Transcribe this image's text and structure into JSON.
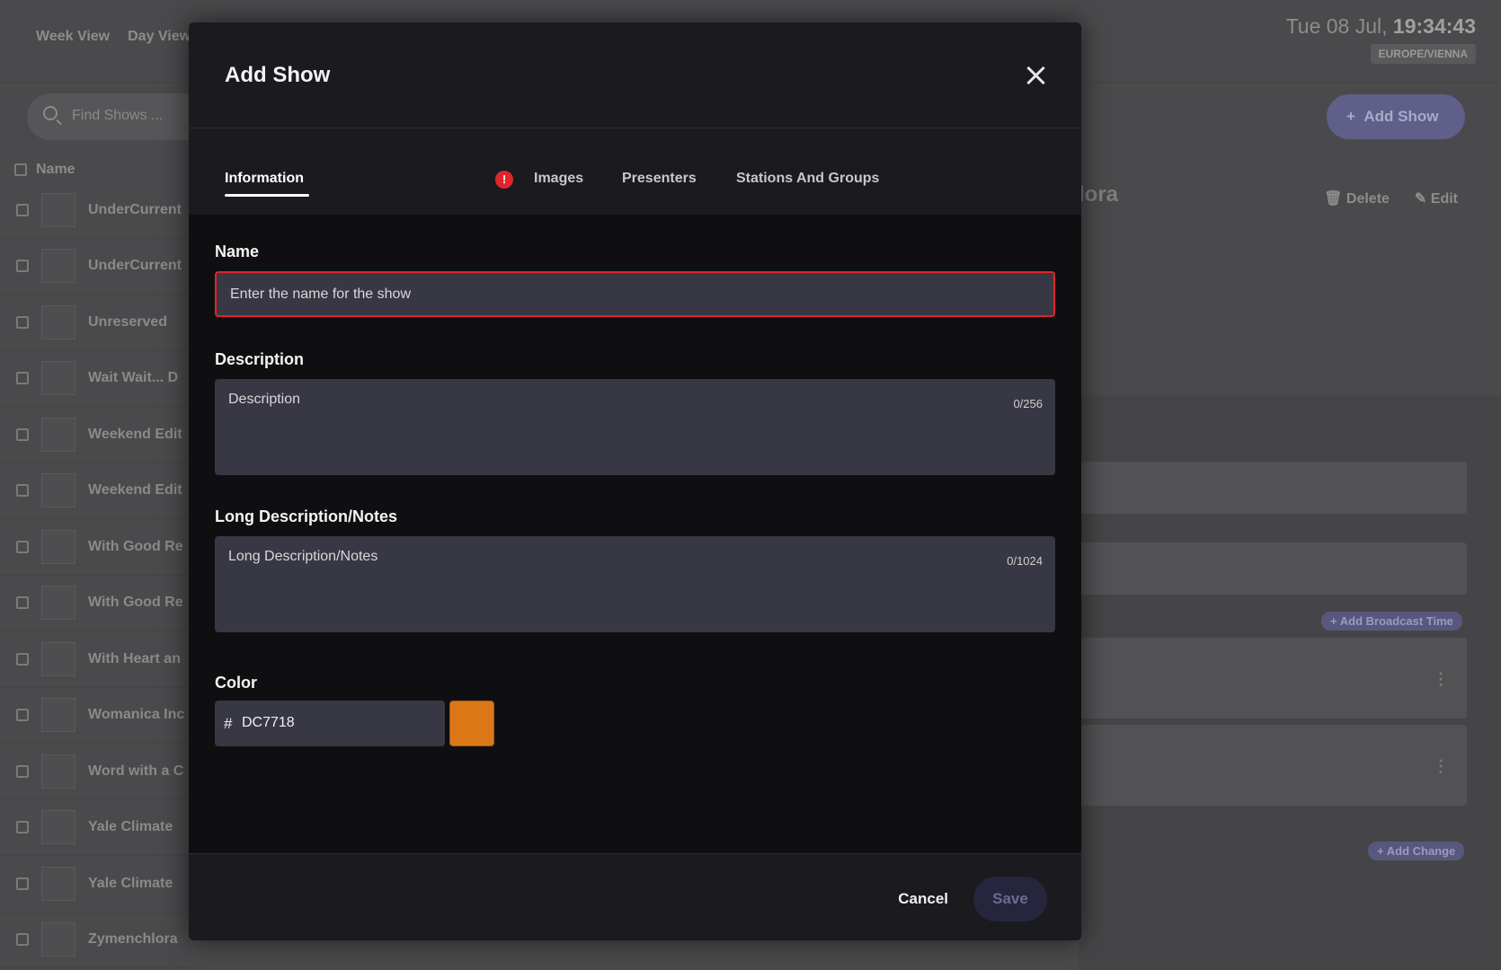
{
  "background": {
    "nav": [
      "Week View",
      "Day View"
    ],
    "clock": {
      "date": "Tue 08 Jul,",
      "time": "19:34:43",
      "timezone": "EUROPE/VIENNA"
    },
    "search_placeholder": "Find Shows ...",
    "list_header": "Name",
    "shows": [
      "UnderCurrent",
      "UnderCurrent",
      "Unreserved",
      "Wait Wait... D",
      "Weekend Edit",
      "Weekend Edit",
      "With Good Re",
      "With Good Re",
      "With Heart an",
      "Womanica Inc",
      "Word with a C",
      "Yale Climate",
      "Yale Climate",
      "Zymenchlora"
    ],
    "add_show_button": "Add Show",
    "delete_label": "Delete",
    "edit_label": "Edit",
    "selected_title_fragment": "lora",
    "add_broadcast_time": "Add Broadcast Time",
    "add_change": "Add Change"
  },
  "modal": {
    "title": "Add Show",
    "tabs": [
      {
        "label": "Information",
        "active": true,
        "has_error": true
      },
      {
        "label": "Images",
        "active": false
      },
      {
        "label": "Presenters",
        "active": false
      },
      {
        "label": "Stations And Groups",
        "active": false
      }
    ],
    "error_badge": "!",
    "fields": {
      "name": {
        "label": "Name",
        "placeholder": "Enter the name for the show",
        "value": ""
      },
      "description": {
        "label": "Description",
        "placeholder": "Description",
        "counter": "0/256"
      },
      "long_description": {
        "label": "Long Description/Notes",
        "placeholder": "Long Description/Notes",
        "counter": "0/1024"
      },
      "color": {
        "label": "Color",
        "prefix": "#",
        "value": "DC7718",
        "swatch": "#DC7718"
      }
    },
    "footer": {
      "cancel": "Cancel",
      "save": "Save"
    }
  },
  "colors": {
    "error": "#E0262A",
    "accent": "#5F5F8A",
    "swatch": "#DC7718"
  }
}
